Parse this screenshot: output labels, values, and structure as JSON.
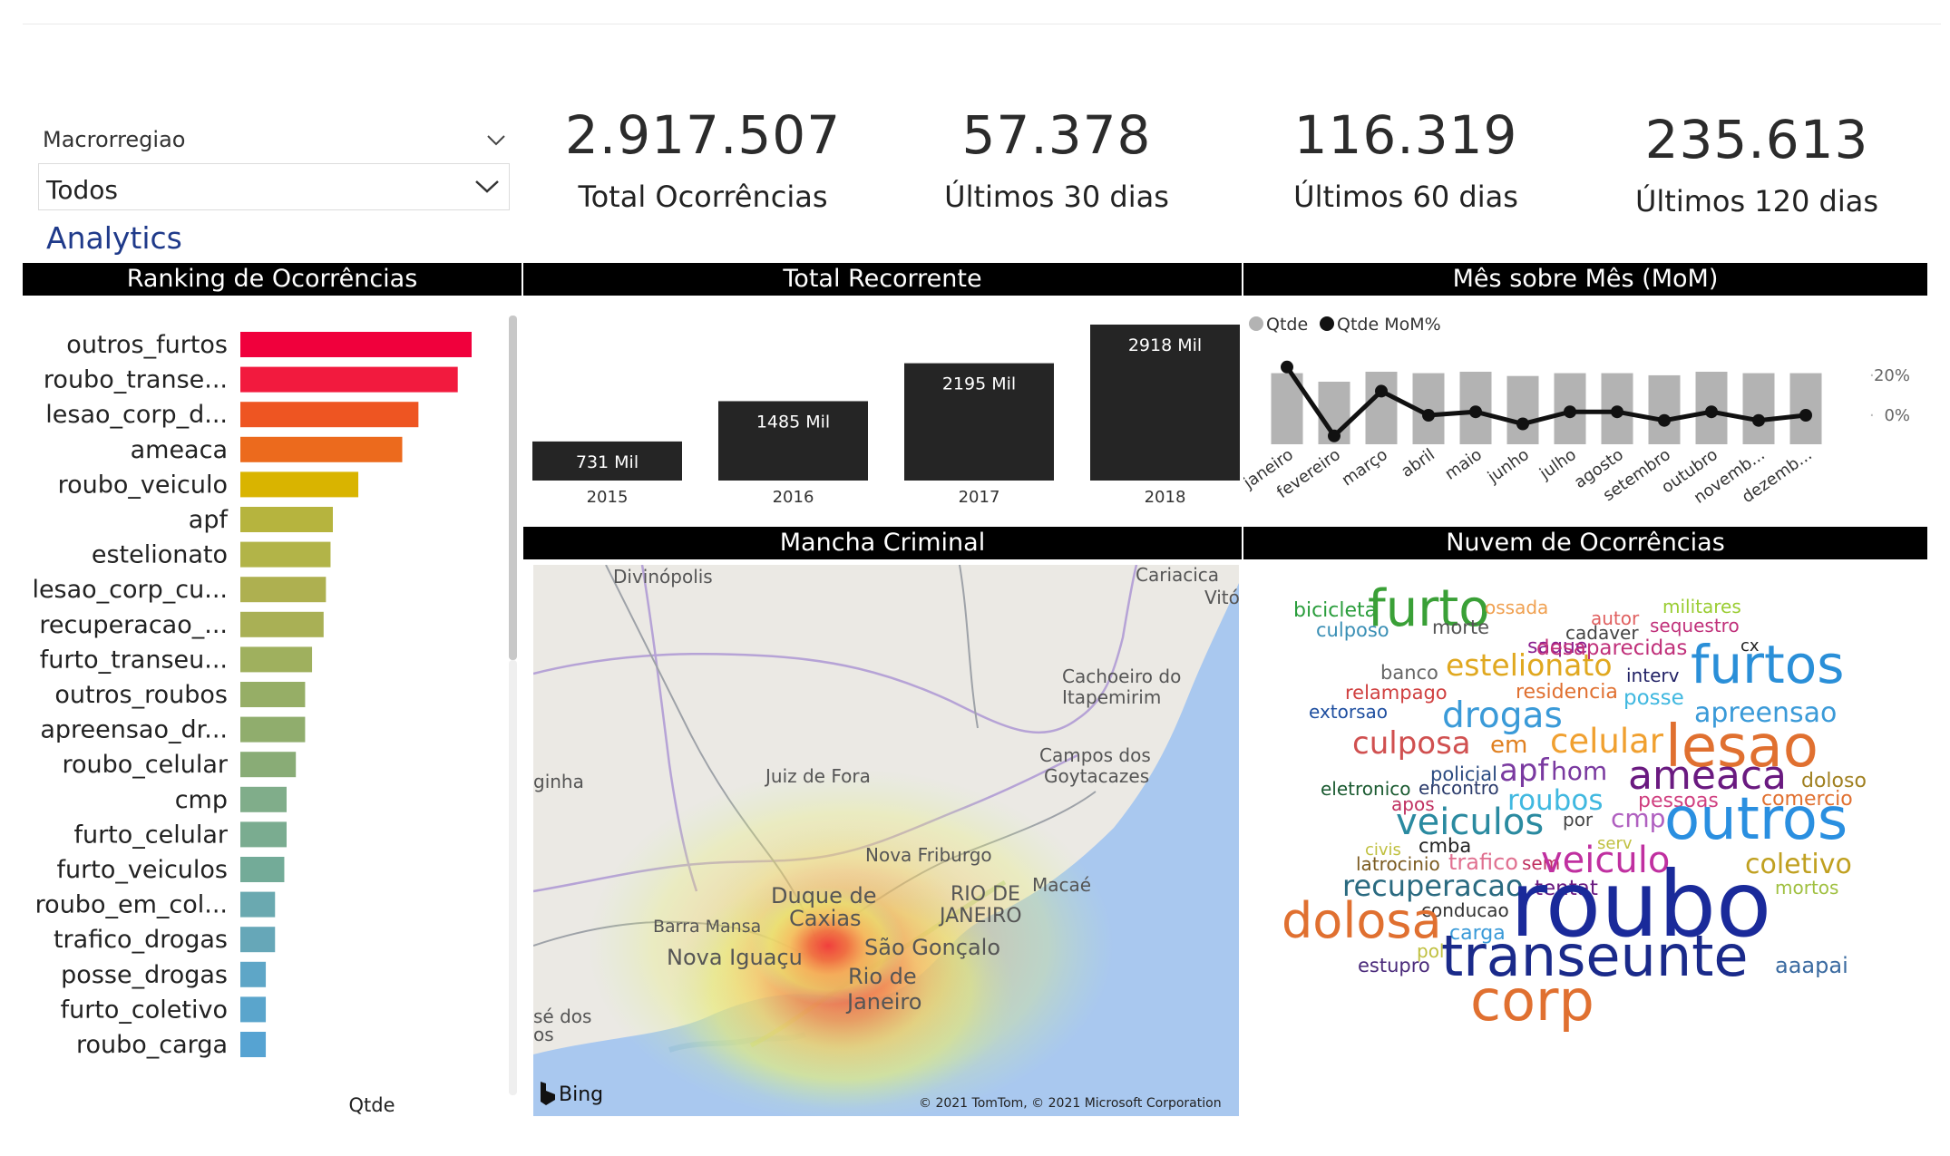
{
  "slicer": {
    "label": "Macrorregiao",
    "value": "Todos"
  },
  "analytics_label": "Analytics",
  "kpis": [
    {
      "value": "2.917.507",
      "label": "Total Ocorrências"
    },
    {
      "value": "57.378",
      "label": "Últimos 30 dias"
    },
    {
      "value": "116.319",
      "label": "Últimos 60 dias"
    },
    {
      "value": "235.613",
      "label": "Últimos 120 dias"
    }
  ],
  "panels": {
    "ranking": "Ranking de Ocorrências",
    "recorrente": "Total Recorrente",
    "mom": "Mês sobre Mês (MoM)",
    "mancha": "Mancha Criminal",
    "nuvem": "Nuvem de Ocorrências"
  },
  "chart_data": [
    {
      "type": "bar",
      "orientation": "horizontal",
      "xlabel": "Qtde",
      "categories": [
        "outros_furtos",
        "roubo_transe...",
        "lesao_corp_d...",
        "ameaca",
        "roubo_veiculo",
        "apf",
        "estelionato",
        "lesao_corp_cu...",
        "recuperacao_...",
        "furto_transeu...",
        "outros_roubos",
        "apreensao_dr...",
        "roubo_celular",
        "cmp",
        "furto_celular",
        "furto_veiculos",
        "roubo_em_col...",
        "trafico_drogas",
        "posse_drogas",
        "furto_coletivo",
        "roubo_carga"
      ],
      "values": [
        100,
        94,
        77,
        70,
        51,
        40,
        39,
        37,
        36,
        31,
        28,
        28,
        24,
        20,
        20,
        19,
        15,
        15,
        11,
        11,
        11
      ],
      "colors": [
        "#f0003c",
        "#f21a3e",
        "#ee5522",
        "#ec6a1d",
        "#d9b400",
        "#b6b43e",
        "#b2b448",
        "#aeb050",
        "#a9b055",
        "#9fb05e",
        "#96ae66",
        "#90ad6d",
        "#89ac76",
        "#80ad8a",
        "#7aac90",
        "#73ab98",
        "#6aa9b0",
        "#66a7b8",
        "#5ea6c7",
        "#5aa5cc",
        "#56a3d2"
      ],
      "grid": false,
      "legend": "none"
    },
    {
      "type": "bar",
      "categories": [
        "2015",
        "2016",
        "2017",
        "2018"
      ],
      "values": [
        731,
        1485,
        2195,
        2918
      ],
      "data_labels": [
        "731 Mil",
        "1485 Mil",
        "2195 Mil",
        "2918 Mil"
      ],
      "color": "#252525"
    },
    {
      "type": "bar+line",
      "categories": [
        "janeiro",
        "fevereiro",
        "março",
        "abril",
        "maio",
        "junho",
        "julho",
        "agosto",
        "setembro",
        "outubro",
        "novemb...",
        "dezemb..."
      ],
      "series": [
        {
          "name": "Qtde",
          "type": "bar",
          "color": "#b3b3b3",
          "values": [
            100,
            88,
            102,
            100,
            102,
            96,
            100,
            100,
            97,
            102,
            100,
            100
          ]
        },
        {
          "name": "Qtde MoM%",
          "type": "line",
          "color": "#111111",
          "values": [
            28,
            -12,
            14,
            0,
            2,
            -5,
            2,
            2,
            -3,
            2,
            -3,
            0
          ]
        }
      ],
      "y2_ticks": [
        "20%",
        "0%"
      ],
      "legend": "top-left"
    }
  ],
  "map": {
    "places": [
      "Divinópolis",
      "Cariacica",
      "Vitó",
      "Cachoeiro do",
      "Itapemirim",
      "Campos dos",
      "Goytacazes",
      "Juiz de Fora",
      "ginha",
      "Nova Friburgo",
      "Macaé",
      "RIO DE",
      "JANEIRO",
      "Duque de",
      "Caxias",
      "Barra Mansa",
      "São Gonçalo",
      "Nova Iguaçu",
      "Rio de",
      "Janeiro",
      "sé dos",
      "os"
    ],
    "brand": "Bing",
    "copyright": "© 2021 TomTom, © 2021 Microsoft Corporation"
  },
  "wordcloud": [
    {
      "t": "bicicleta",
      "c": "#2a9d3c"
    },
    {
      "t": "furto",
      "c": "#3aa037"
    },
    {
      "t": "ossada",
      "c": "#f0a050"
    },
    {
      "t": "militares",
      "c": "#9acd32"
    },
    {
      "t": "culposo",
      "c": "#3a8fb5"
    },
    {
      "t": "morte",
      "c": "#555555"
    },
    {
      "t": "autor",
      "c": "#e06060"
    },
    {
      "t": "sequestro",
      "c": "#c0307a"
    },
    {
      "t": "cadaver",
      "c": "#444444"
    },
    {
      "t": "saque",
      "c": "#8b2090"
    },
    {
      "t": "desaparecidas",
      "c": "#c0307a"
    },
    {
      "t": "cx",
      "c": "#222222"
    },
    {
      "t": "furtos",
      "c": "#2a8fd8"
    },
    {
      "t": "banco",
      "c": "#666666"
    },
    {
      "t": "estelionato",
      "c": "#e0a820"
    },
    {
      "t": "interv",
      "c": "#222266"
    },
    {
      "t": "relampago",
      "c": "#d04040"
    },
    {
      "t": "residencia",
      "c": "#e07030"
    },
    {
      "t": "posse",
      "c": "#40b8e0"
    },
    {
      "t": "extorsao",
      "c": "#1f4fa0"
    },
    {
      "t": "drogas",
      "c": "#3a9ad8"
    },
    {
      "t": "apreensao",
      "c": "#3a9ad8"
    },
    {
      "t": "culposa",
      "c": "#d05050"
    },
    {
      "t": "em",
      "c": "#e08020"
    },
    {
      "t": "celular",
      "c": "#f0a030"
    },
    {
      "t": "lesao",
      "c": "#e07030"
    },
    {
      "t": "policial",
      "c": "#2a4a80"
    },
    {
      "t": "apf",
      "c": "#7a3aa0"
    },
    {
      "t": "hom",
      "c": "#7a3aa0"
    },
    {
      "t": "ameaca",
      "c": "#6a1a80"
    },
    {
      "t": "doloso",
      "c": "#a08020"
    },
    {
      "t": "eletronico",
      "c": "#1a5a30"
    },
    {
      "t": "encontro",
      "c": "#2a3a6a"
    },
    {
      "t": "roubos",
      "c": "#40b8e0"
    },
    {
      "t": "pessoas",
      "c": "#d04080"
    },
    {
      "t": "comercio",
      "c": "#e07030"
    },
    {
      "t": "apos",
      "c": "#c03060"
    },
    {
      "t": "veiculos",
      "c": "#2a8aa0"
    },
    {
      "t": "por",
      "c": "#444444"
    },
    {
      "t": "cmp",
      "c": "#b060c0"
    },
    {
      "t": "outros",
      "c": "#2a8fe0"
    },
    {
      "t": "civis",
      "c": "#c0c040"
    },
    {
      "t": "cmba",
      "c": "#222222"
    },
    {
      "t": "serv",
      "c": "#c0c040"
    },
    {
      "t": "latrocinio",
      "c": "#7a5a20"
    },
    {
      "t": "trafico",
      "c": "#e07090"
    },
    {
      "t": "sem",
      "c": "#c03060"
    },
    {
      "t": "veiculo",
      "c": "#c030a0"
    },
    {
      "t": "coletivo",
      "c": "#c0a020"
    },
    {
      "t": "recuperacao",
      "c": "#2a6a80"
    },
    {
      "t": "tentat",
      "c": "#6a1a80"
    },
    {
      "t": "mortos",
      "c": "#a0c040"
    },
    {
      "t": "conducao",
      "c": "#333333"
    },
    {
      "t": "dolosa",
      "c": "#e07030"
    },
    {
      "t": "carga",
      "c": "#3a9ad8"
    },
    {
      "t": "roubo",
      "c": "#1a2a9a"
    },
    {
      "t": "pol",
      "c": "#c0c040"
    },
    {
      "t": "estupro",
      "c": "#4a2a7a"
    },
    {
      "t": "transeunte",
      "c": "#1a2a8a"
    },
    {
      "t": "aaapai",
      "c": "#3a6aa0"
    },
    {
      "t": "corp",
      "c": "#e07030"
    }
  ]
}
